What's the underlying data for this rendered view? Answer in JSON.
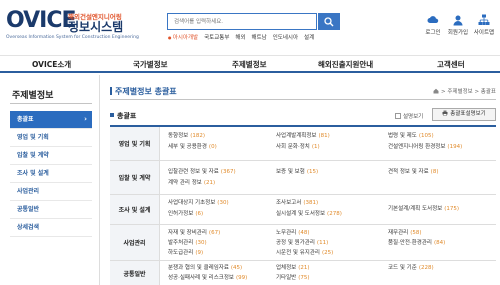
{
  "logo": {
    "brand": "OVICE",
    "kr_top": "해외건설엔지니어링",
    "kr_main": "정보시스템",
    "subtitle": "Overseas Information System for Construction Engineering"
  },
  "search": {
    "placeholder": "검색어를 입력하세요.",
    "quick_links": [
      "아시아개발",
      "국토교통부",
      "해외",
      "해트남",
      "인도네시아",
      "설계"
    ]
  },
  "utility": [
    {
      "label": "로그인",
      "icon": "cloud-icon"
    },
    {
      "label": "회원가입",
      "icon": "user-icon"
    },
    {
      "label": "사이트맵",
      "icon": "sitemap-icon"
    }
  ],
  "gnb": [
    "OVICE소개",
    "국가별정보",
    "주제별정보",
    "해외진출지원안내",
    "고객센터"
  ],
  "sidebar": {
    "title": "주제별정보",
    "items": [
      {
        "label": "총괄표",
        "active": true
      },
      {
        "label": "영업 및 기획",
        "active": false
      },
      {
        "label": "입찰 및 계약",
        "active": false
      },
      {
        "label": "조사 및 설계",
        "active": false
      },
      {
        "label": "사업관리",
        "active": false
      },
      {
        "label": "공통일반",
        "active": false
      },
      {
        "label": "상세검색",
        "active": false
      }
    ]
  },
  "content": {
    "title": "주제별정보 총괄표",
    "breadcrumb": "> 주제별정보 > 총괄표",
    "section_title": "총괄표",
    "desc_toggle": "설명보기",
    "print_button": "총괄표설명보기"
  },
  "table": [
    {
      "header": "영업 및 기획",
      "cols": [
        [
          "동향정보 (182)",
          "세부 및 공용환경 (0)"
        ],
        [
          "사업계발계획정보 (81)",
          "사회 문화·정치 (1)"
        ],
        [
          "법령 및 제도 (105)",
          "건설엔지니어링 환경정보 (194)"
        ]
      ]
    },
    {
      "header": "입찰 및 계약",
      "cols": [
        [
          "입찰관련 정보 및 자료 (367)",
          "계약 관리 정보 (21)"
        ],
        [
          "보증 및 보험 (15)"
        ],
        [
          "견적 정보 및 자료 (8)"
        ]
      ]
    },
    {
      "header": "조사 및 설계",
      "cols": [
        [
          "사업대상지 기초정보 (30)",
          "인허가정보 (6)"
        ],
        [
          "조사보고서 (381)",
          "실시설계 및 도서정보 (278)"
        ],
        [
          "기본설계/계획 도서정보 (175)"
        ]
      ]
    },
    {
      "header": "사업관리",
      "cols": [
        [
          "자재 및 장비관리 (67)",
          "발주처관리 (30)",
          "하도급관리 (9)"
        ],
        [
          "노무관리 (48)",
          "공정 및 원가관리 (11)",
          "시운전 및 유지관리 (25)"
        ],
        [
          "재무관리 (58)",
          "품질·안전·환경관리 (84)"
        ]
      ]
    },
    {
      "header": "공통일반",
      "cols": [
        [
          "분쟁과 협의 및 클레임자료 (45)",
          "성공·실패사례 및 리스크정보 (99)"
        ],
        [
          "업체정보 (21)",
          "기타일반 (75)"
        ],
        [
          "코드 및 기준 (228)"
        ]
      ]
    }
  ],
  "colors": {
    "primary": "#2b5e9e",
    "active_bg": "#2b6cbf",
    "accent": "#e0532a",
    "count": "#e08a2a"
  }
}
